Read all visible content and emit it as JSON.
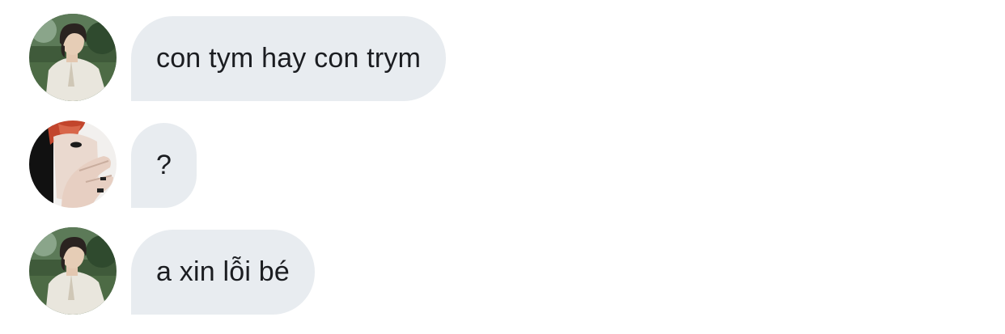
{
  "messages": [
    {
      "text": "con tym hay con trym",
      "avatar": "avatar-garden"
    },
    {
      "text": "?",
      "avatar": "avatar-redhair"
    },
    {
      "text": "a xin lỗi bé",
      "avatar": "avatar-garden"
    }
  ],
  "colors": {
    "bubble_bg": "#e8ecf0",
    "bubble_text": "#1b1d21",
    "page_bg": "#ffffff"
  }
}
